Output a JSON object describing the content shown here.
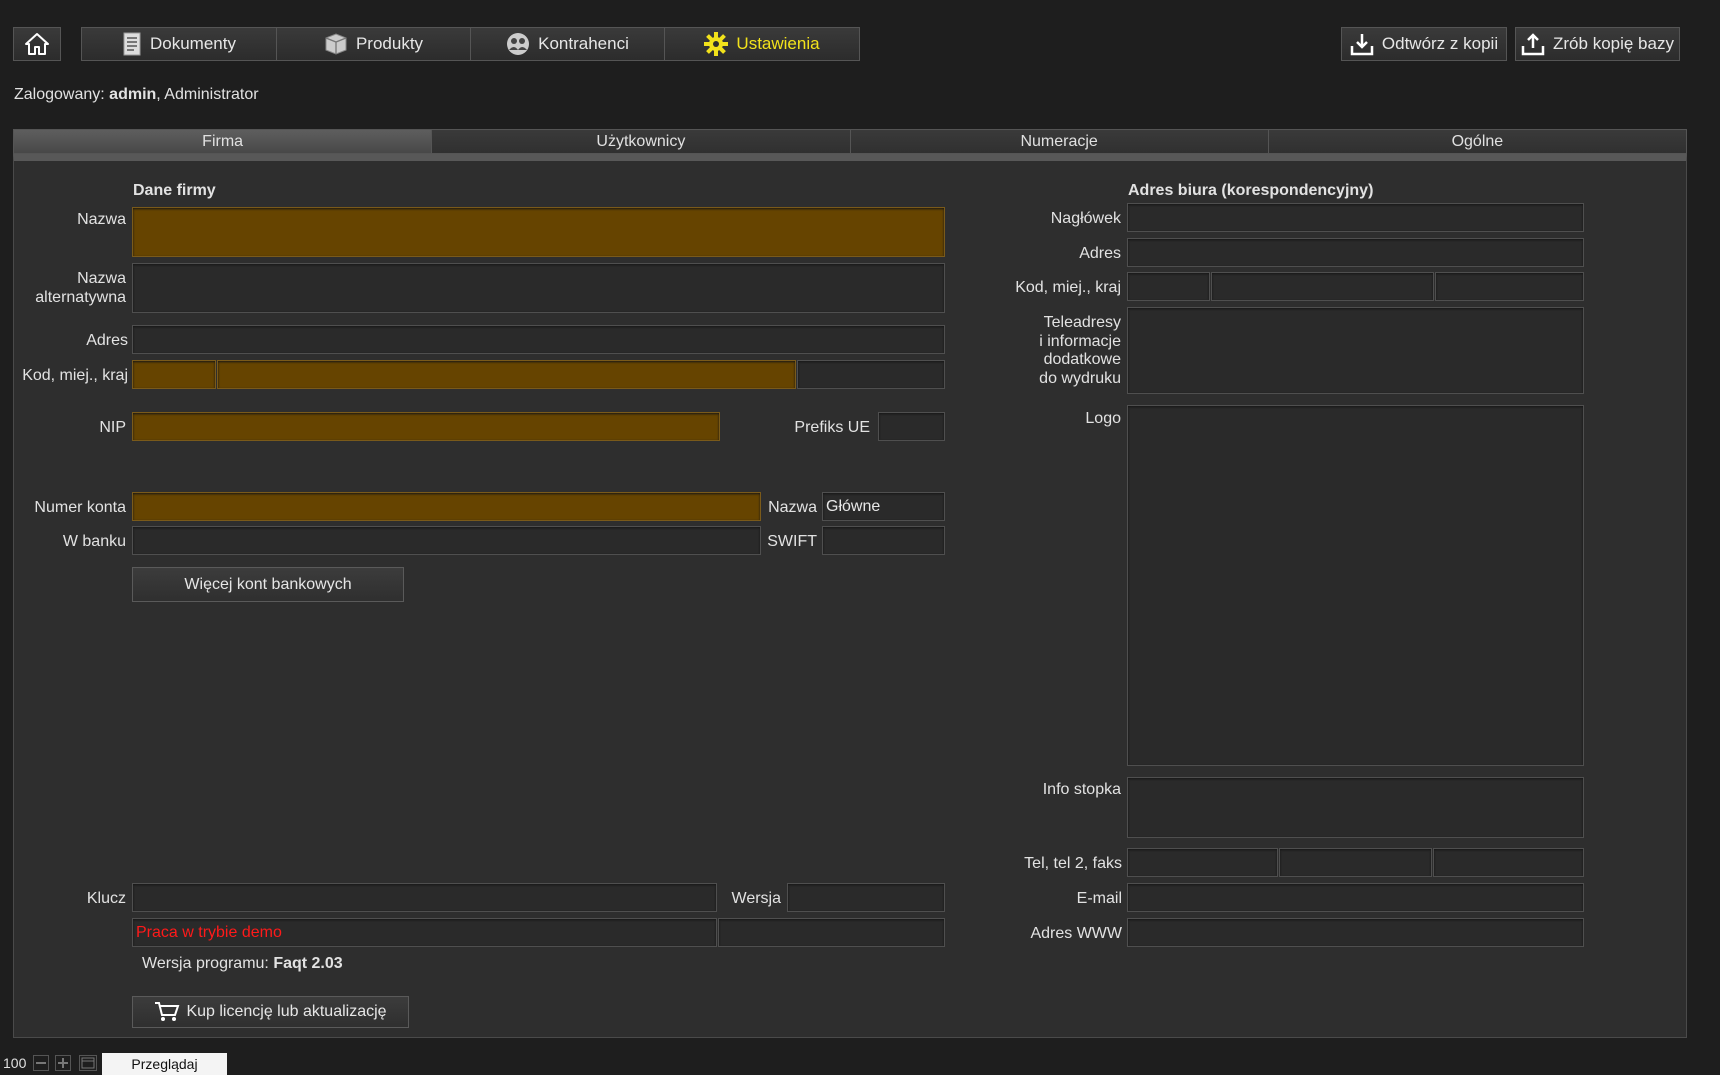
{
  "toolbar": {
    "nav": [
      {
        "label": "Dokumenty",
        "icon": "document-icon"
      },
      {
        "label": "Produkty",
        "icon": "box-icon"
      },
      {
        "label": "Kontrahenci",
        "icon": "people-icon"
      },
      {
        "label": "Ustawienia",
        "icon": "gear-icon"
      }
    ],
    "restore_label": "Odtwórz z kopii",
    "backup_label": "Zrób kopię bazy",
    "accent": "#f2e21b"
  },
  "login": {
    "prefix": "Zalogowany: ",
    "user": "admin",
    "role": ", Administrator"
  },
  "tabs": [
    "Firma",
    "Użytkownicy",
    "Numeracje",
    "Ogólne"
  ],
  "company": {
    "section": "Dane firmy",
    "name_label": "Nazwa",
    "alt_name_label_1": "Nazwa",
    "alt_name_label_2": "alternatywna",
    "address_label": "Adres",
    "postal_label": "Kod, miej., kraj",
    "nip_label": "NIP",
    "eu_prefix_label": "Prefiks UE",
    "account_label": "Numer konta",
    "account_name_label": "Nazwa",
    "account_name_value": "Główne",
    "bank_label": "W banku",
    "swift_label": "SWIFT",
    "more_accounts_button": "Więcej kont bankowych",
    "key_label": "Klucz",
    "version_label": "Wersja",
    "demo_text": "Praca w trybie demo",
    "program_version_prefix": "Wersja programu: ",
    "program_version": "Faqt 2.03",
    "buy_button": "Kup licencję lub aktualizację",
    "required_color": "#664400"
  },
  "office": {
    "section": "Adres biura (korespondencyjny)",
    "header_label": "Nagłówek",
    "address_label": "Adres",
    "postal_label": "Kod, miej., kraj",
    "teleaddress_lines": [
      "Teleadresy",
      "i informacje",
      "dodatkowe",
      "do wydruku"
    ],
    "logo_label": "Logo",
    "footer_label": "Info stopka",
    "phone_label": "Tel, tel 2, faks",
    "email_label": "E-mail",
    "www_label": "Adres WWW"
  },
  "status": {
    "zoom": "100",
    "mode": "Przeglądaj"
  }
}
